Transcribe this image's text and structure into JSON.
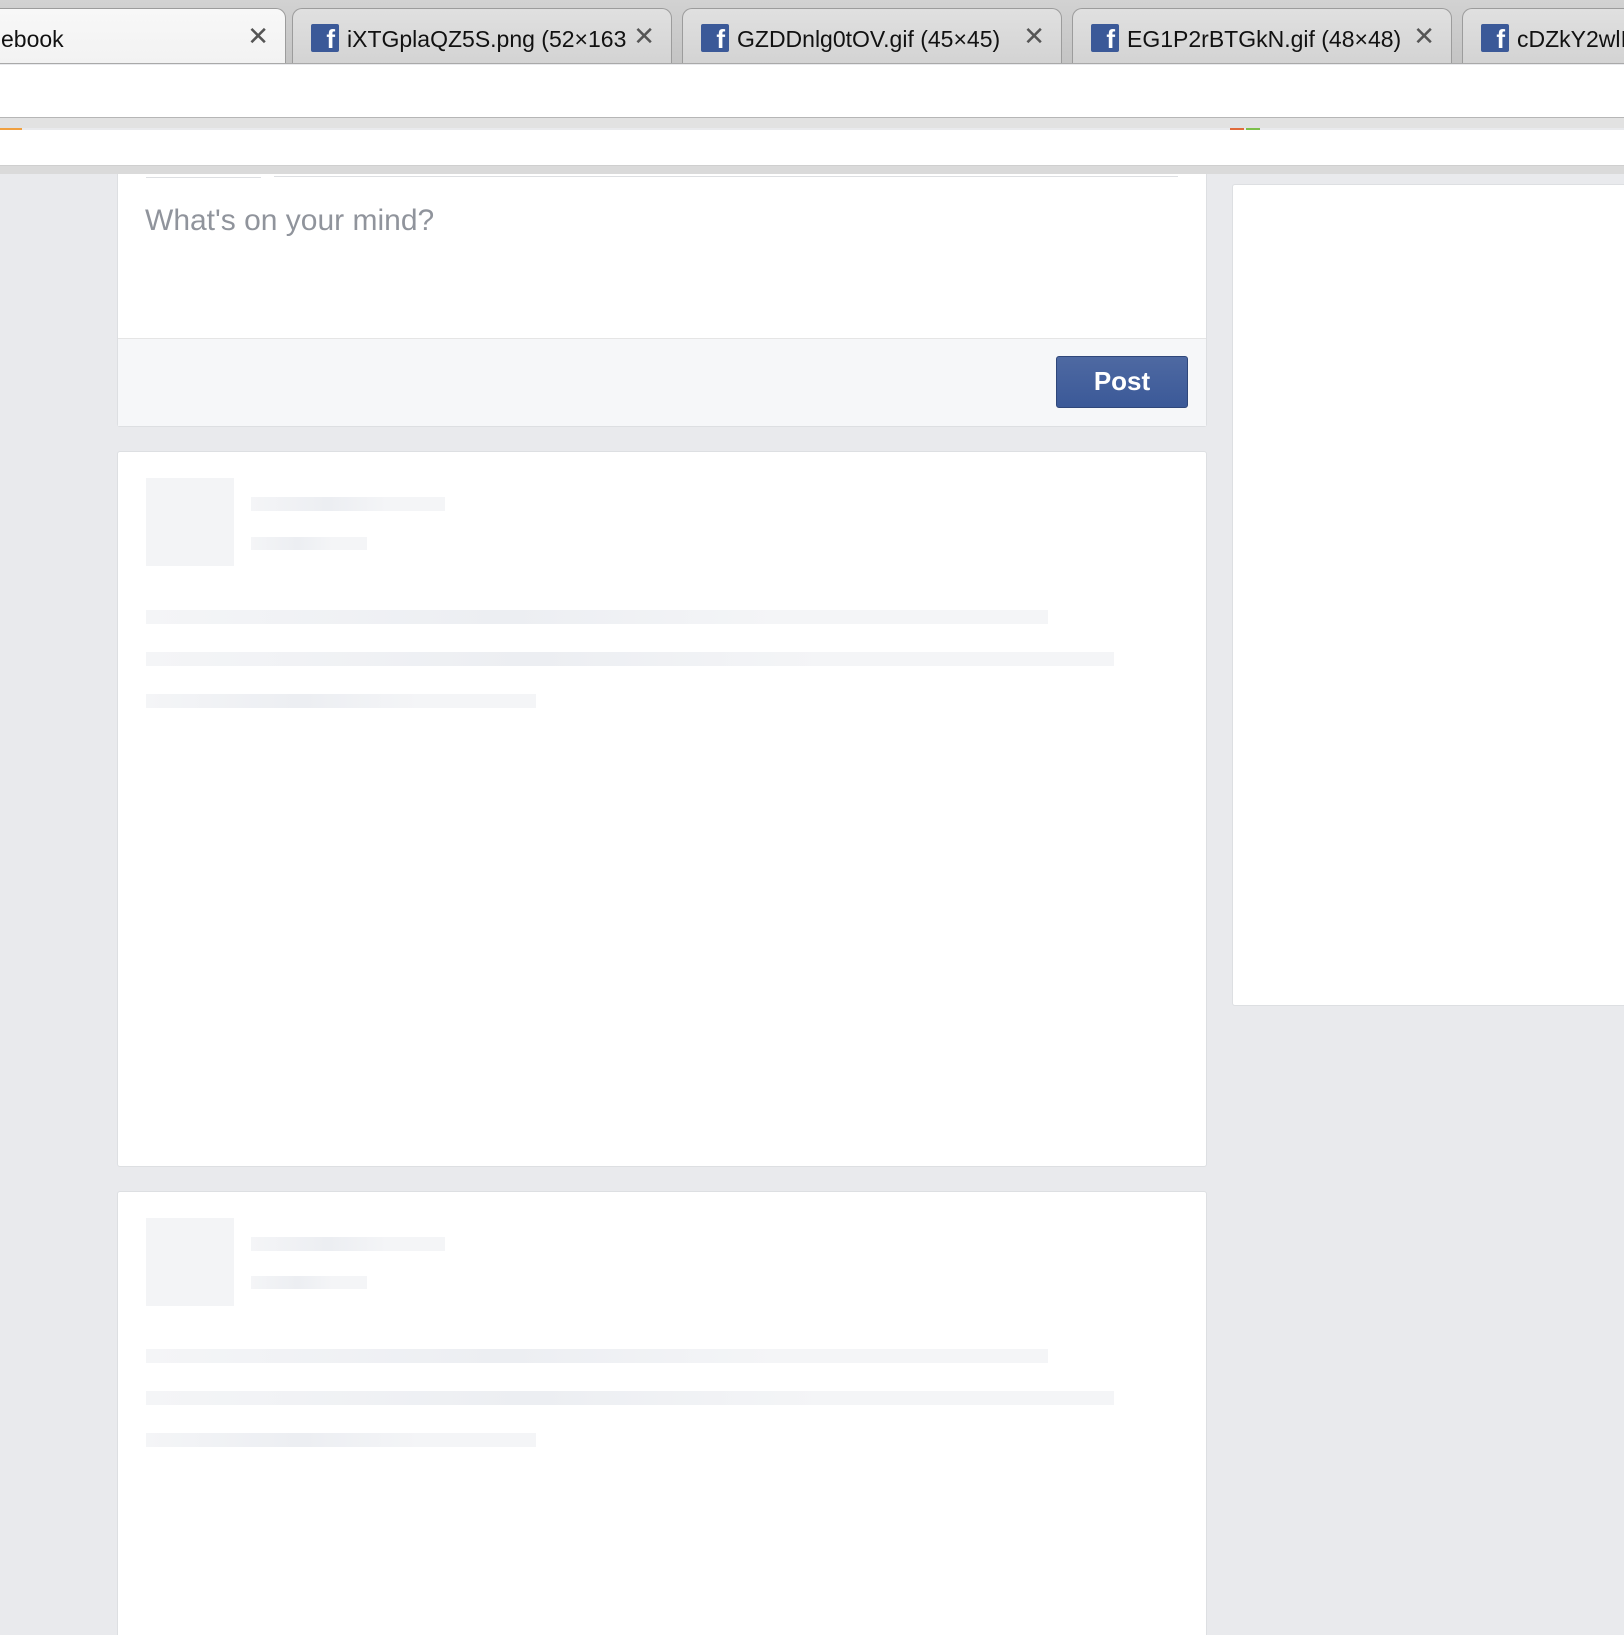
{
  "browser": {
    "tabs": [
      {
        "title": "ebook",
        "close": "✕",
        "active": true
      },
      {
        "title": "iXTGplaQZ5S.png (52×163",
        "close": "✕"
      },
      {
        "title": "GZDDnlg0tOV.gif (45×45)",
        "close": "✕"
      },
      {
        "title": "EG1P2rBTGkN.gif (48×48)",
        "close": "✕"
      },
      {
        "title": "cDZkY2wlI",
        "close": ""
      }
    ],
    "favicon_icon": "facebook-f-icon",
    "accent": "#3b5998"
  },
  "composer": {
    "placeholder": "What's on your mind?",
    "post_label": "Post"
  },
  "colors": {
    "page_bg": "#e9eaed",
    "button_bg": "#4267b2",
    "placeholder_text": "#90949c",
    "skeleton": "#f3f4f6"
  }
}
